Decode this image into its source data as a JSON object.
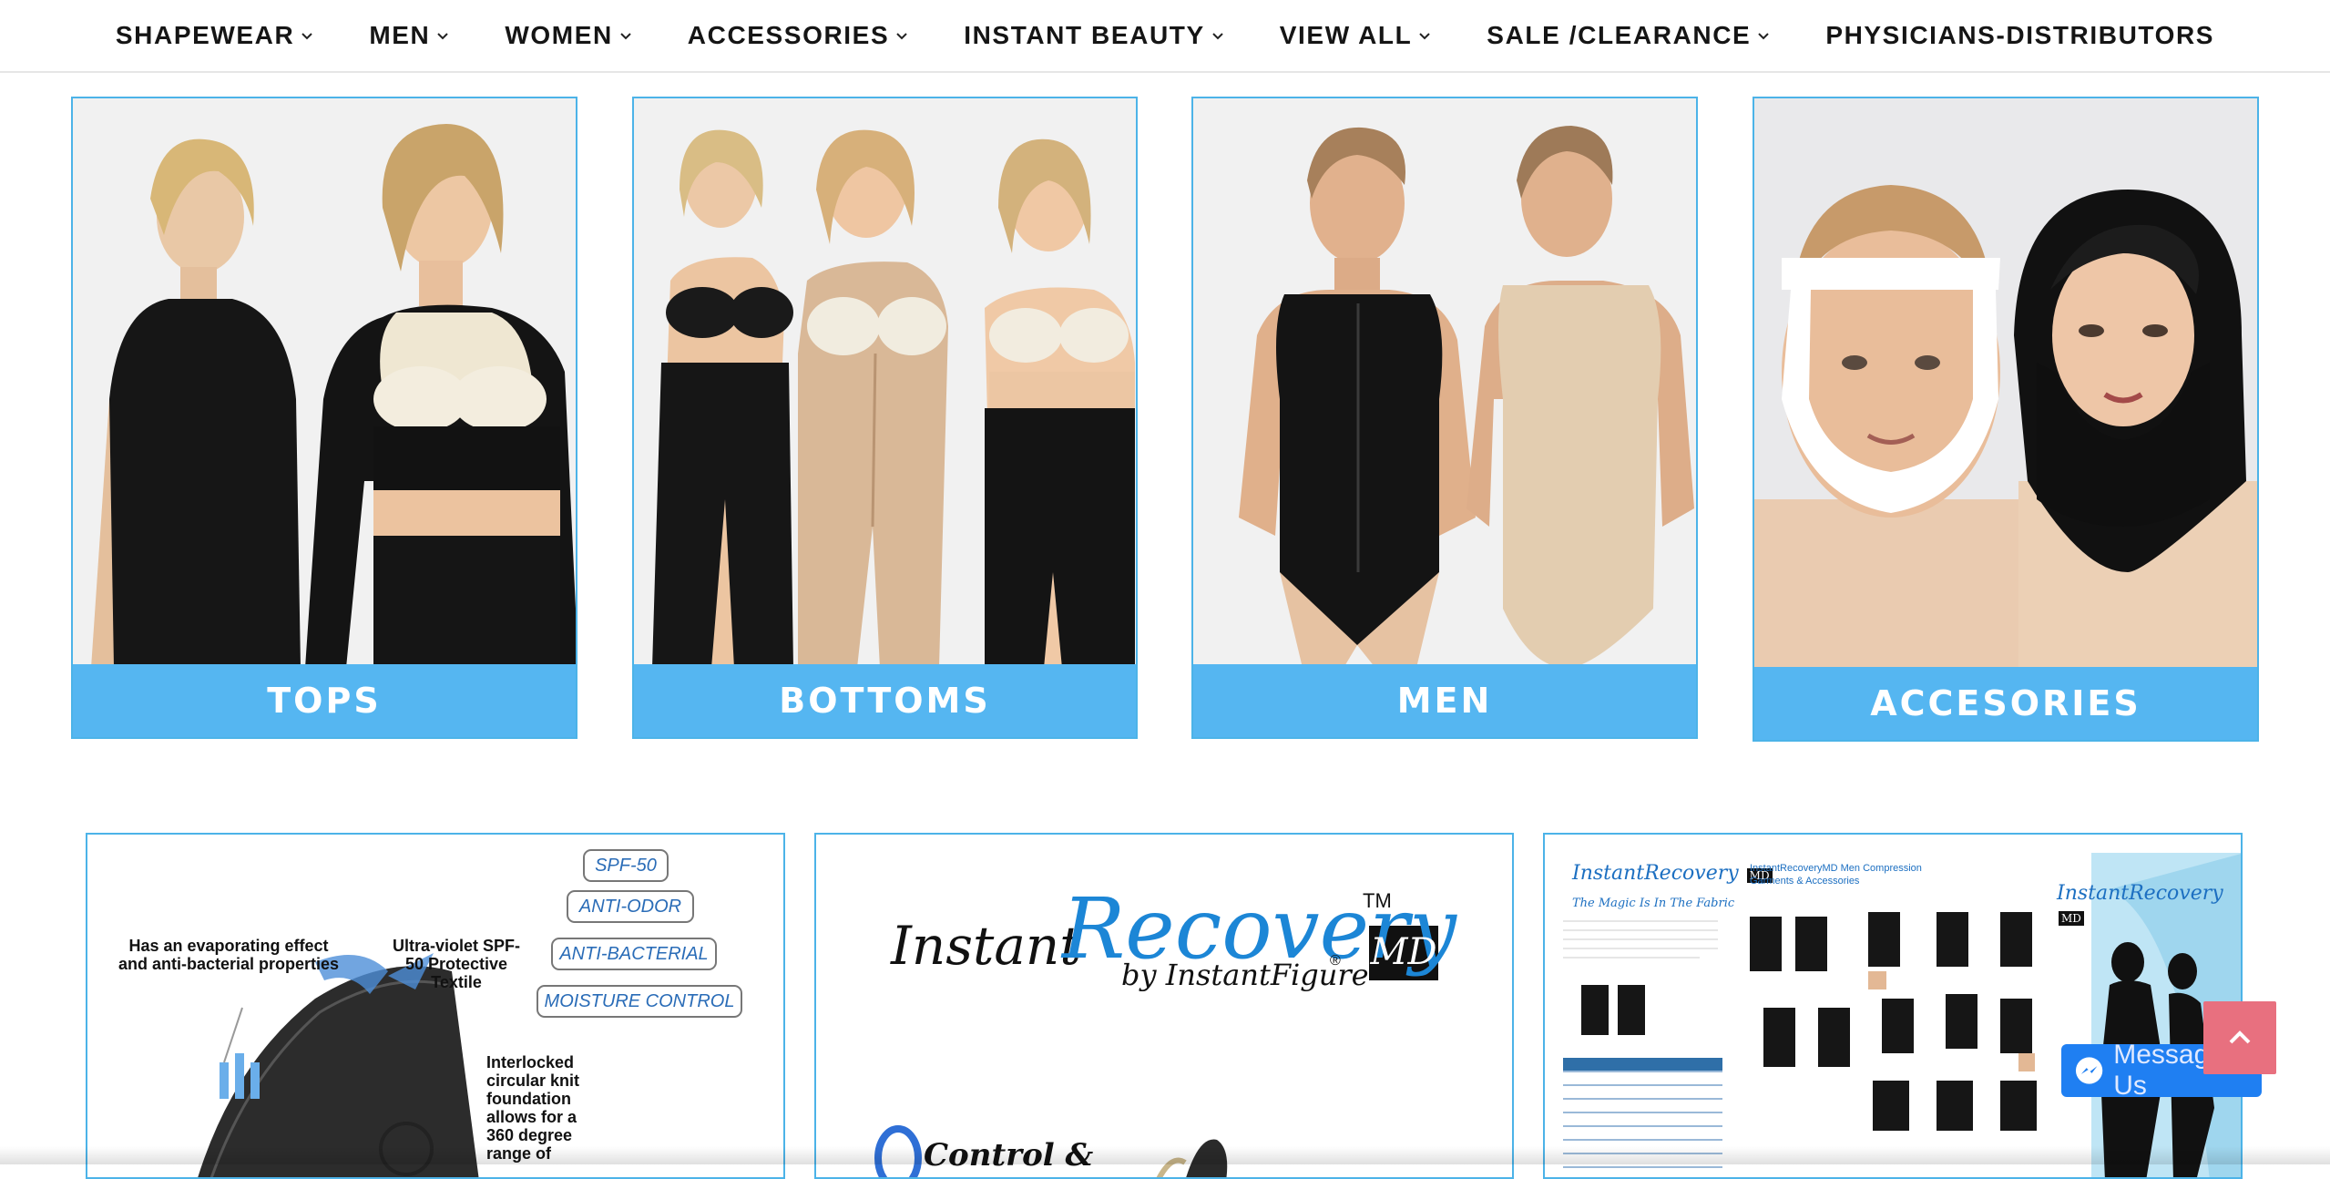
{
  "nav": {
    "items": [
      {
        "label": "SHAPEWEAR",
        "has_dropdown": true
      },
      {
        "label": "MEN",
        "has_dropdown": true
      },
      {
        "label": "WOMEN",
        "has_dropdown": true
      },
      {
        "label": "ACCESSORIES",
        "has_dropdown": true
      },
      {
        "label": "INSTANT BEAUTY",
        "has_dropdown": true
      },
      {
        "label": "VIEW ALL",
        "has_dropdown": true
      },
      {
        "label": "SALE /CLEARANCE",
        "has_dropdown": true
      },
      {
        "label": "PHYSICIANS-DISTRIBUTORS",
        "has_dropdown": false
      }
    ]
  },
  "categories": [
    {
      "label": "TOPS"
    },
    {
      "label": "BOTTOMS"
    },
    {
      "label": "MEN"
    },
    {
      "label": "ACCESORIES"
    }
  ],
  "fabric_tile": {
    "badges": [
      "SPF-50",
      "ANTI-ODOR",
      "ANTI-BACTERIAL",
      "MOISTURE CONTROL"
    ],
    "callout_left": "Has an evaporating effect and anti-bacterial properties",
    "callout_right": "Ultra-violet SPF-50 Protective Textile",
    "callout_bottom": "Interlocked circular knit foundation allows for a 360 degree range of"
  },
  "brand_tile": {
    "instant": "Instant",
    "recovery": "Recovery",
    "tm": "TM",
    "md": "MD",
    "by_line": "by InstantFigure",
    "reg": "®",
    "partial": "Control &"
  },
  "catalog_tile": {
    "logo_left": "InstantRecovery",
    "logo_right": "InstantRecovery",
    "md": "MD",
    "heading": "InstantRecoveryMD Men Compression Garments & Accessories",
    "tagline": "The Magic Is In The Fabric"
  },
  "widgets": {
    "messenger_label": "Message Us",
    "to_top_icon": "chevron-up-icon",
    "messenger_icon": "messenger-icon"
  },
  "colors": {
    "accent_blue": "#55b6f1",
    "card_border": "#4cb3e8",
    "to_top": "#e8707f",
    "messenger": "#1f7ff2"
  }
}
